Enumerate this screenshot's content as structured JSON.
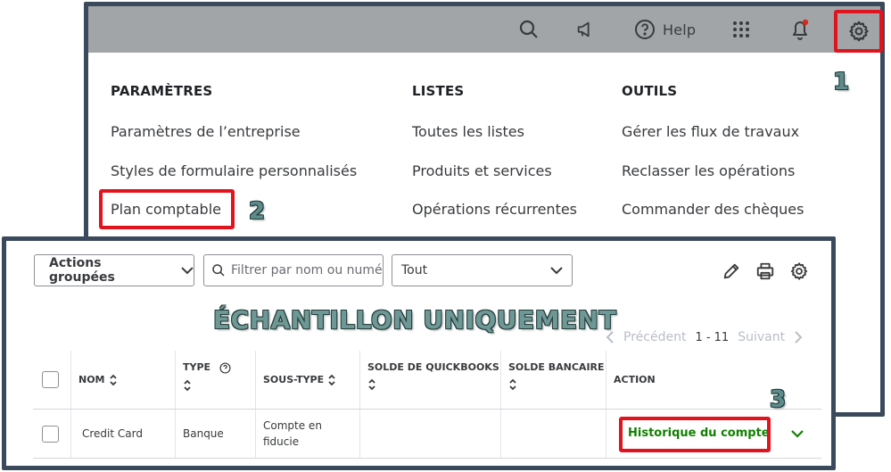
{
  "topbar": {
    "help_label": "Help",
    "icons": [
      "search-icon",
      "megaphone-icon",
      "help-icon",
      "apps-grid-icon",
      "bell-icon",
      "gear-icon"
    ]
  },
  "menu": {
    "columns": [
      {
        "heading": "PARAMÈTRES",
        "items": [
          "Paramètres de l’entreprise",
          "Styles de formulaire personnalisés",
          "Plan comptable"
        ]
      },
      {
        "heading": "LISTES",
        "items": [
          "Toutes les listes",
          "Produits et services",
          "Opérations récurrentes"
        ]
      },
      {
        "heading": "OUTILS",
        "items": [
          "Gérer les flux de travaux",
          "Reclasser les opérations",
          "Commander des chèques"
        ]
      }
    ]
  },
  "steps": {
    "one": "1",
    "two": "2",
    "three": "3"
  },
  "toolbar": {
    "bulk_actions": "Actions groupées",
    "filter_placeholder": "Filtrer par nom ou numéro",
    "type_select": "Tout"
  },
  "watermark": "ÉCHANTILLON UNIQUEMENT",
  "pager": {
    "prev": "Précédent",
    "range": "1 - 11",
    "next": "Suivant"
  },
  "table": {
    "headers": [
      "NOM",
      "TYPE",
      "SOUS-TYPE",
      "SOLDE DE QUICKBOOKS",
      "SOLDE BANCAIRE",
      "ACTION"
    ],
    "rows": [
      {
        "nom": "Credit Card",
        "type": "Banque",
        "sous_type": "Compte en fiducie",
        "solde_qb": "",
        "solde_bancaire": "",
        "action": "Historique du compte"
      }
    ]
  },
  "colors": {
    "accent_green": "#108000",
    "highlight_red": "#e0141e",
    "topbar_gray": "#a2a5a8"
  }
}
